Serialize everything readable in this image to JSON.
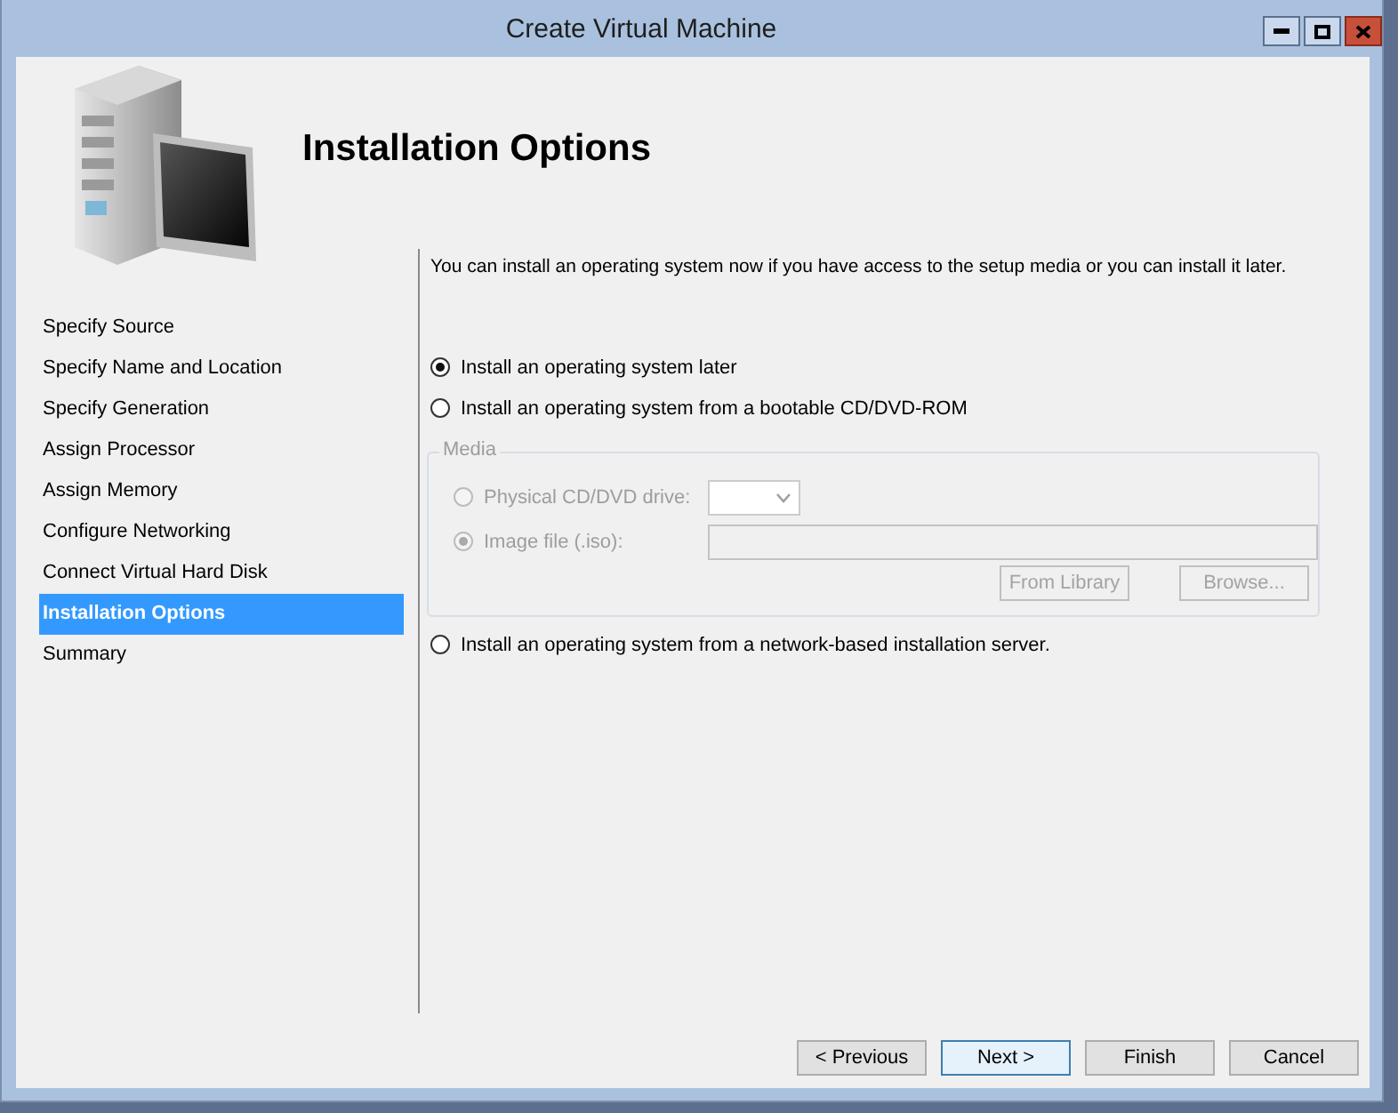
{
  "window": {
    "title": "Create Virtual Machine"
  },
  "page_title": "Installation Options",
  "steps": [
    {
      "label": "Specify Source",
      "selected": false
    },
    {
      "label": "Specify Name and Location",
      "selected": false
    },
    {
      "label": "Specify Generation",
      "selected": false
    },
    {
      "label": "Assign Processor",
      "selected": false
    },
    {
      "label": "Assign Memory",
      "selected": false
    },
    {
      "label": "Configure Networking",
      "selected": false
    },
    {
      "label": "Connect Virtual Hard Disk",
      "selected": false
    },
    {
      "label": "Installation Options",
      "selected": true
    },
    {
      "label": "Summary",
      "selected": false
    }
  ],
  "description": "You can install an operating system now if you have access to the setup media or you can install it later.",
  "options": [
    {
      "label": "Install an operating system later",
      "selected": true
    },
    {
      "label": "Install an operating system from a bootable CD/DVD-ROM",
      "selected": false
    },
    {
      "label": "Install an operating system from a network-based installation server.",
      "selected": false
    }
  ],
  "media": {
    "label": "Media",
    "disabled": true,
    "rows": [
      {
        "label": "Physical CD/DVD drive:",
        "selected": false,
        "kind": "dropdown"
      },
      {
        "label": "Image file (.iso):",
        "selected": true,
        "kind": "text"
      }
    ],
    "buttons": [
      "From Library",
      "Browse..."
    ]
  },
  "buttons": [
    {
      "label": "< Previous",
      "default": false
    },
    {
      "label": "Next >",
      "default": true
    },
    {
      "label": "Finish",
      "default": false
    },
    {
      "label": "Cancel",
      "default": false
    }
  ]
}
